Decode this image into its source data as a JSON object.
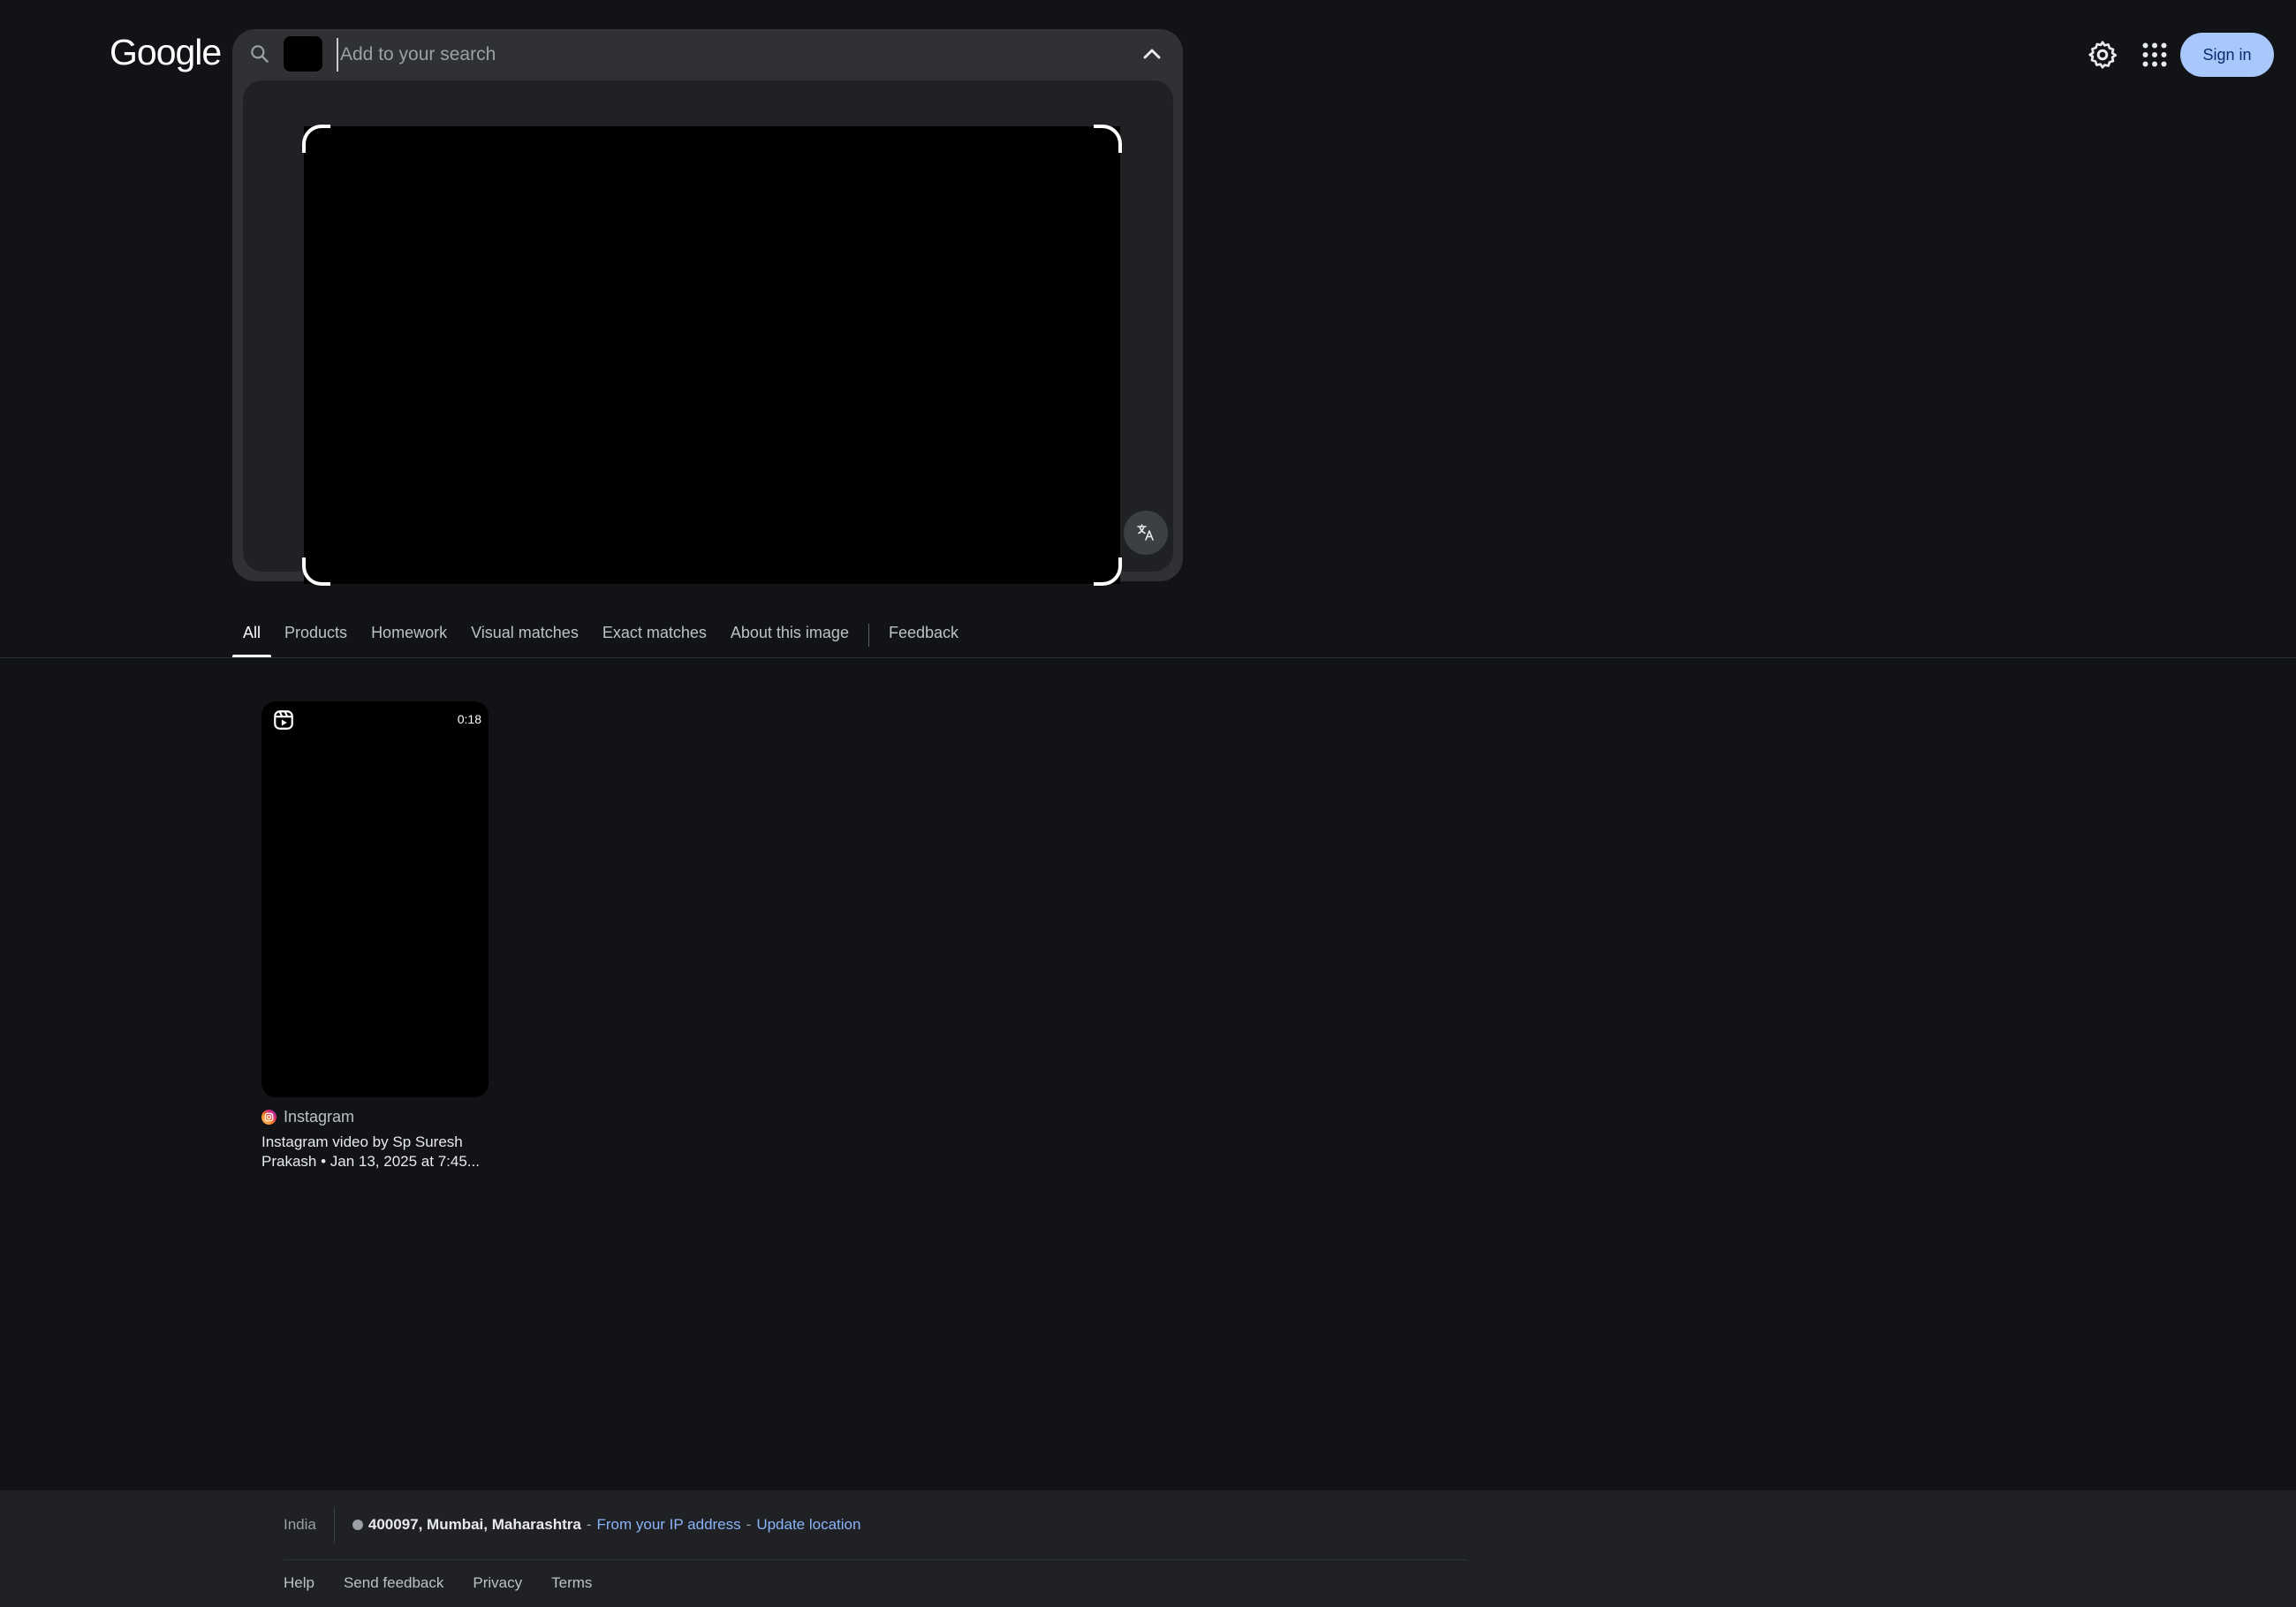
{
  "header": {
    "logo_text": "Google",
    "signin_label": "Sign in",
    "settings_icon": "gear-icon",
    "apps_icon": "apps-grid-icon"
  },
  "search": {
    "placeholder": "Add to your search",
    "value": ""
  },
  "tabs": [
    {
      "label": "All",
      "active": true
    },
    {
      "label": "Products"
    },
    {
      "label": "Homework"
    },
    {
      "label": "Visual matches"
    },
    {
      "label": "Exact matches"
    },
    {
      "label": "About this image"
    },
    {
      "label": "Feedback"
    }
  ],
  "results": [
    {
      "duration": "0:18",
      "source": "Instagram",
      "title": "Instagram video by Sp Suresh Prakash • Jan 13, 2025 at 7:45..."
    }
  ],
  "footer": {
    "country": "India",
    "location": "400097, Mumbai, Maharashtra",
    "separator": "-",
    "ip_source": "From your IP address",
    "update_location": "Update location",
    "links": [
      "Help",
      "Send feedback",
      "Privacy",
      "Terms"
    ]
  },
  "colors": {
    "background": "#111317",
    "panel": "#303134",
    "accent_button": "#a8c7fa",
    "link": "#8ab4f8"
  }
}
